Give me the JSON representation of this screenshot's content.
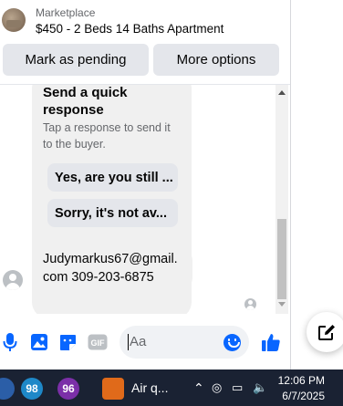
{
  "listing": {
    "label": "Marketplace",
    "title": "$450 - 2 Beds 14 Baths Apartment"
  },
  "actions": {
    "mark_pending": "Mark as pending",
    "more_options": "More options"
  },
  "quick_response": {
    "title": "Send a quick response",
    "subtitle": "Tap a response to send it to the buyer.",
    "chips": [
      "Yes, are you still ...",
      "Sorry, it's not av..."
    ]
  },
  "message": {
    "line1": "Judymarkus67@gmail.",
    "line2": "com 309-203-6875"
  },
  "composer": {
    "placeholder": "Aa",
    "icons": [
      "mic-icon",
      "photo-icon",
      "sticker-icon",
      "gif-icon",
      "emoji-icon",
      "like-icon"
    ],
    "gif_label": "GIF"
  },
  "taskbar": {
    "badge1": "98",
    "badge2": "96",
    "weather_label": "Air q...",
    "time": "12:06 PM",
    "date": "6/7/2025"
  },
  "colors": {
    "accent": "#0866ff",
    "bubble": "#f0f0f0",
    "button": "#e4e6eb",
    "taskbar": "#1a2233"
  }
}
